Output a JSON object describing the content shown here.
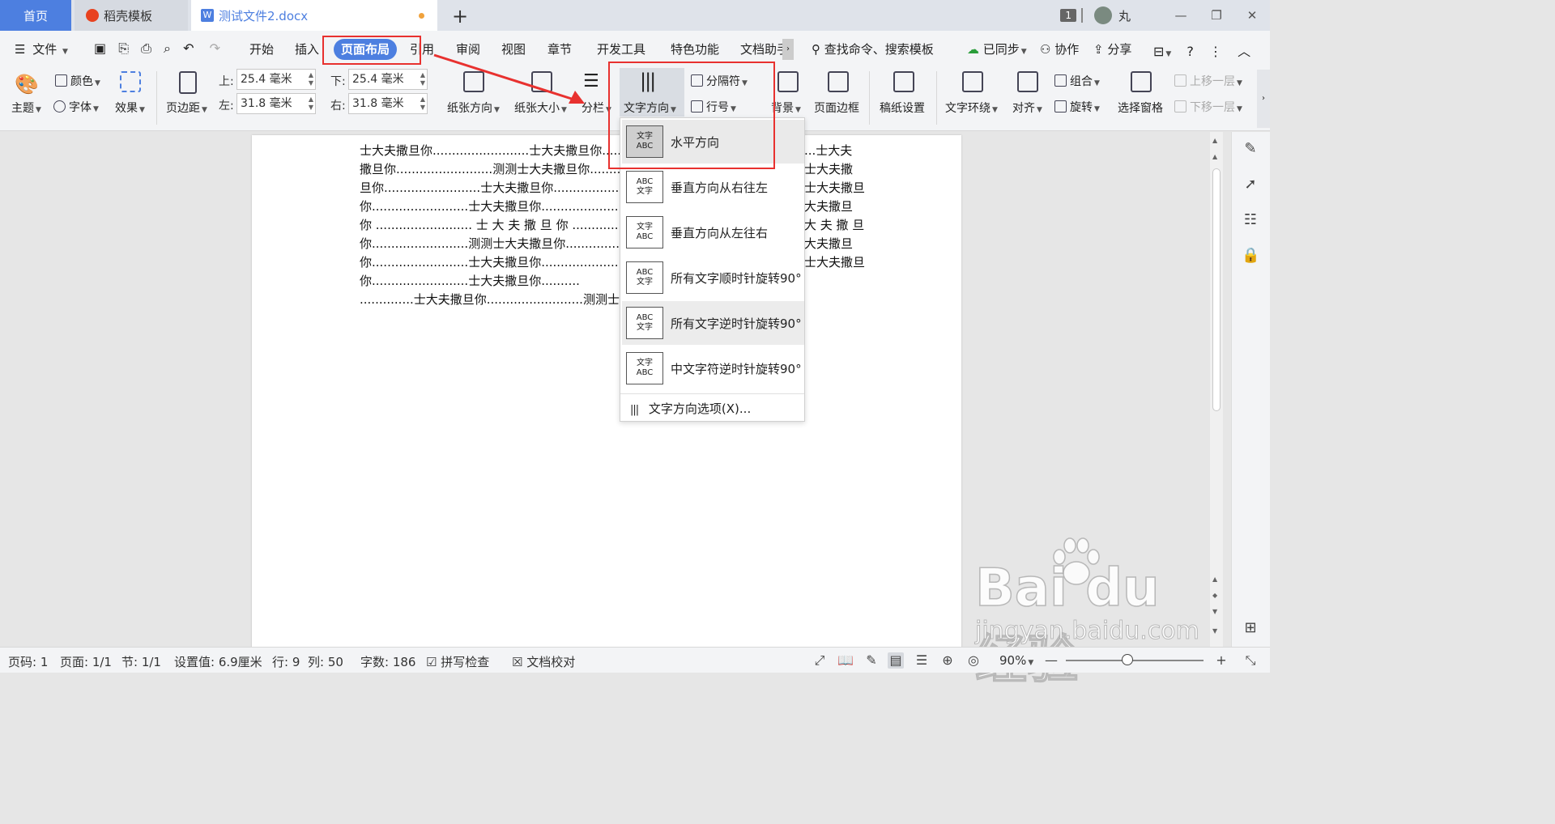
{
  "tabs": {
    "home": "首页",
    "template": "稻壳模板",
    "document": "测试文件2.docx",
    "add": "+"
  },
  "titlebar": {
    "window_count": "1",
    "user_name": "丸"
  },
  "menu": {
    "file": "文件",
    "items": [
      "开始",
      "插入",
      "页面布局",
      "引用",
      "审阅",
      "视图",
      "章节",
      "开发工具",
      "特色功能",
      "文档助手"
    ],
    "active": "页面布局",
    "search": "查找命令、搜索模板",
    "sync": "已同步",
    "collab": "协作",
    "share": "分享"
  },
  "ribbon": {
    "theme": "主题",
    "color": "颜色",
    "font": "字体",
    "effect": "效果",
    "margins": "页边距",
    "top_label": "上:",
    "top_value": "25.4 毫米",
    "bottom_label": "下:",
    "bottom_value": "25.4 毫米",
    "left_label": "左:",
    "left_value": "31.8 毫米",
    "right_label": "右:",
    "right_value": "31.8 毫米",
    "orientation": "纸张方向",
    "size": "纸张大小",
    "columns": "分栏",
    "text_direction": "文字方向",
    "separator": "分隔符",
    "line_number": "行号",
    "background": "背景",
    "page_border": "页面边框",
    "manuscript": "稿纸设置",
    "wrap": "文字环绕",
    "align": "对齐",
    "group": "组合",
    "rotate": "旋转",
    "selection_pane": "选择窗格",
    "bring_forward": "上移一层",
    "send_backward": "下移一层"
  },
  "document": {
    "lines": [
      "士大夫撒旦你.........................士大夫撒旦你...........",
      "撒旦你.........................测测士大夫撒旦你..........",
      "旦你.........................士大夫撒旦你..........................测",
      "你.........................士大夫撒旦你.........................士",
      "你 ......................... 士 大 夫 撒 旦 你 ......................... 士",
      "你.........................测测士大夫撒旦你.........................",
      "你.........................士大夫撒旦你.........................测",
      "你.........................士大夫撒旦你..........",
      "..............士大夫撒旦你.........................测测士大夫撒"
    ],
    "right_lines": [
      "...士大夫",
      "士大夫撒",
      "士大夫撒旦",
      "大夫撒旦",
      "大 夫 撒 旦",
      "大夫撒旦",
      "士大夫撒旦"
    ]
  },
  "dropdown": {
    "items": [
      {
        "label": "水平方向",
        "thumb": "文字\nABC"
      },
      {
        "label": "垂直方向从右往左",
        "thumb": "ABC\n文字"
      },
      {
        "label": "垂直方向从左往右",
        "thumb": "文字\nABC"
      },
      {
        "label": "所有文字顺时针旋转90°",
        "thumb": "ABC\n文字"
      },
      {
        "label": "所有文字逆时针旋转90°",
        "thumb": "ABC\n文字"
      },
      {
        "label": "中文字符逆时针旋转90°",
        "thumb": "文字\nABC"
      }
    ],
    "option": "文字方向选项(X)..."
  },
  "status": {
    "page_num": "页码: 1",
    "pages": "页面: 1/1",
    "section": "节: 1/1",
    "setting": "设置值: 6.9厘米",
    "row": "行: 9",
    "col": "列: 50",
    "words": "字数: 186",
    "spell": "拼写检查",
    "proof": "文档校对",
    "zoom": "90%"
  },
  "watermark": {
    "brand": "Bai du 经验",
    "url": "jingyan.baidu.com"
  },
  "colors": {
    "accent": "#4d7fe0",
    "highlight": "#e8312f"
  }
}
